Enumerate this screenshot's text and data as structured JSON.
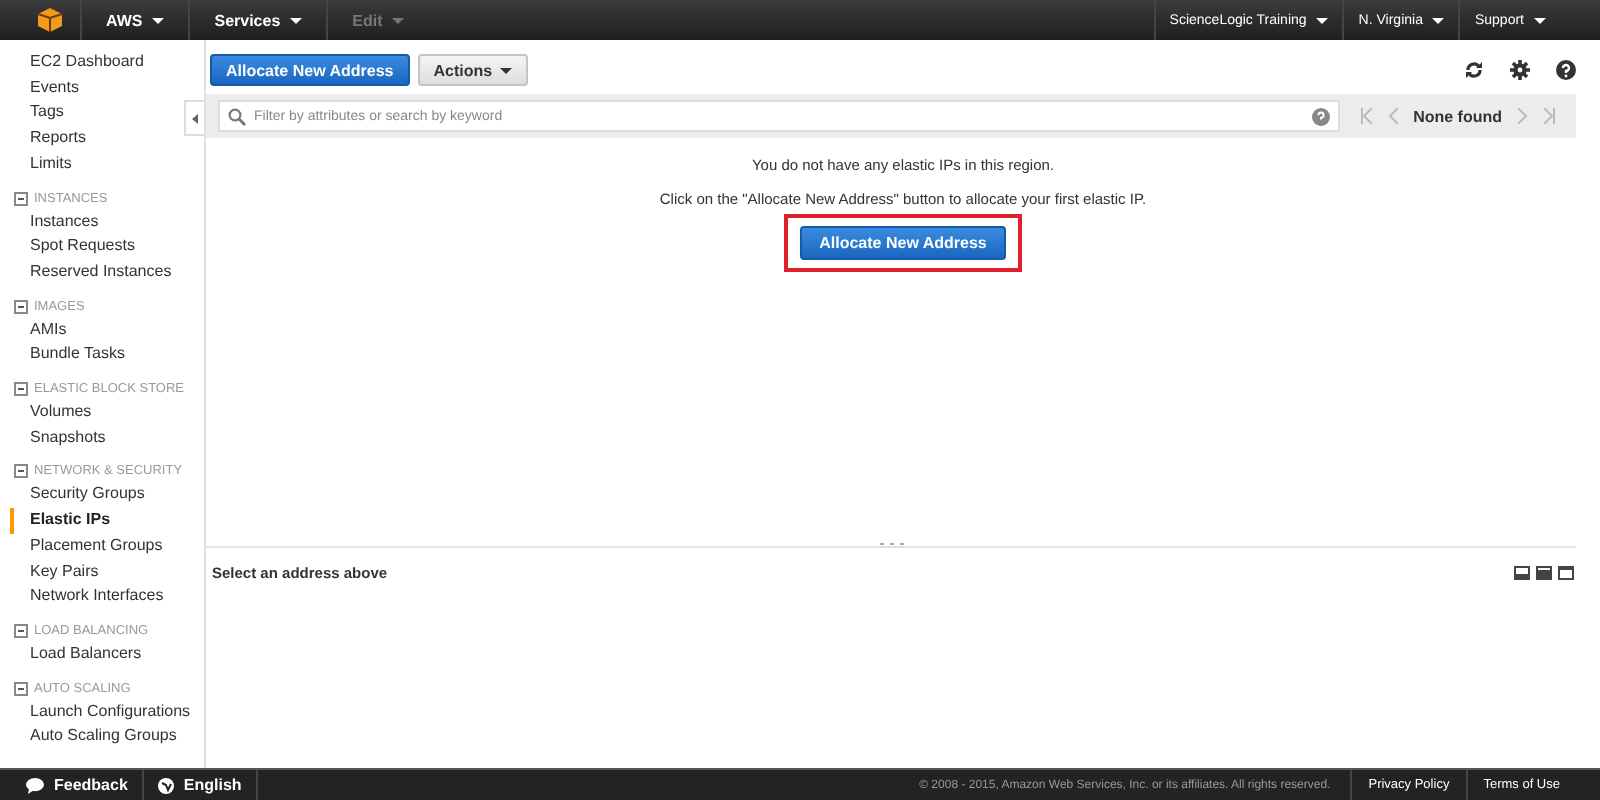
{
  "topbar": {
    "menus": [
      {
        "label": "AWS",
        "disabled": false
      },
      {
        "label": "Services",
        "disabled": false
      },
      {
        "label": "Edit",
        "disabled": true
      }
    ],
    "right": [
      {
        "label": "ScienceLogic Training"
      },
      {
        "label": "N. Virginia"
      },
      {
        "label": "Support"
      }
    ]
  },
  "sidebar": {
    "links": [
      {
        "label": "EC2 Dashboard",
        "selected": false
      },
      {
        "label": "Events",
        "selected": false
      },
      {
        "label": "Tags",
        "selected": false
      },
      {
        "label": "Reports",
        "selected": false
      },
      {
        "label": "Limits",
        "selected": false
      }
    ],
    "sections": [
      {
        "title": "INSTANCES",
        "expanded": true,
        "items": [
          {
            "label": "Instances",
            "selected": false
          },
          {
            "label": "Spot Requests",
            "selected": false
          },
          {
            "label": "Reserved Instances",
            "selected": false
          }
        ]
      },
      {
        "title": "IMAGES",
        "expanded": true,
        "items": [
          {
            "label": "AMIs",
            "selected": false
          },
          {
            "label": "Bundle Tasks",
            "selected": false
          }
        ]
      },
      {
        "title": "ELASTIC BLOCK STORE",
        "expanded": true,
        "items": [
          {
            "label": "Volumes",
            "selected": false
          },
          {
            "label": "Snapshots",
            "selected": false
          }
        ]
      },
      {
        "title": "NETWORK & SECURITY",
        "expanded": true,
        "items": [
          {
            "label": "Security Groups",
            "selected": false
          },
          {
            "label": "Elastic IPs",
            "selected": true
          },
          {
            "label": "Placement Groups",
            "selected": false
          },
          {
            "label": "Key Pairs",
            "selected": false
          },
          {
            "label": "Network Interfaces",
            "selected": false
          }
        ]
      },
      {
        "title": "LOAD BALANCING",
        "expanded": true,
        "items": [
          {
            "label": "Load Balancers",
            "selected": false
          }
        ]
      },
      {
        "title": "AUTO SCALING",
        "expanded": true,
        "items": [
          {
            "label": "Launch Configurations",
            "selected": false
          },
          {
            "label": "Auto Scaling Groups",
            "selected": false
          }
        ]
      }
    ]
  },
  "toolbar": {
    "primary": "Allocate New Address",
    "actions": "Actions"
  },
  "filter": {
    "placeholder": "Filter by attributes or search by keyword",
    "pagination": "None found"
  },
  "empty": {
    "message": "You do not have any elastic IPs in this region.",
    "hint": "Click on the \"Allocate New Address\" button to allocate your first elastic IP.",
    "button": "Allocate New Address",
    "highlighted": true
  },
  "details": {
    "title": "Select an address above"
  },
  "footer": {
    "feedback": "Feedback",
    "language": "English",
    "copyright": "© 2008 - 2015, Amazon Web Services, Inc. or its affiliates. All rights reserved.",
    "links": [
      "Privacy Policy",
      "Terms of Use"
    ]
  }
}
